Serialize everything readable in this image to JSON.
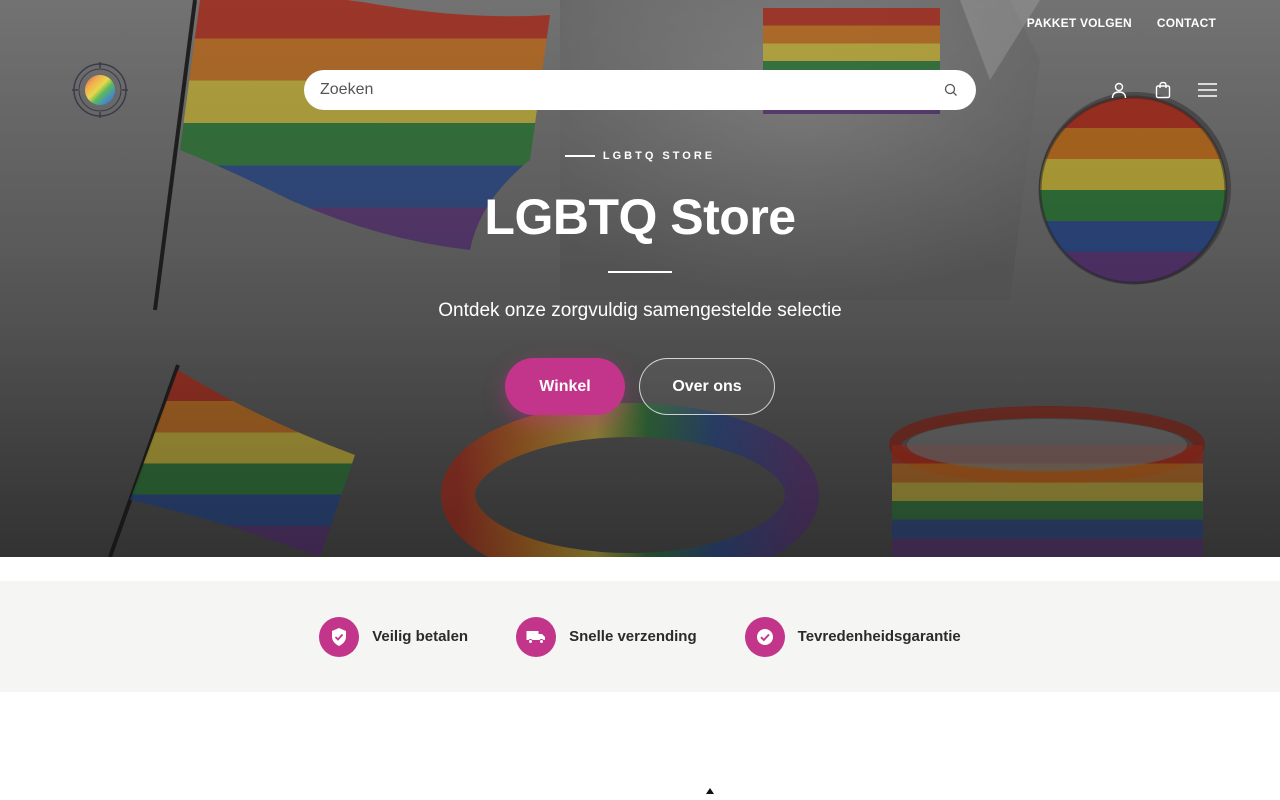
{
  "top_nav": {
    "track_label": "PAKKET VOLGEN",
    "contact_label": "CONTACT"
  },
  "search": {
    "placeholder": "Zoeken",
    "icon": "search-icon"
  },
  "header_icons": [
    "account-icon",
    "bag-icon",
    "menu-icon"
  ],
  "hero": {
    "eyebrow": "LGBTQ STORE",
    "title": "LGBTQ Store",
    "subtitle": "Ontdek onze zorgvuldig samengestelde selectie",
    "primary_button": "Winkel",
    "secondary_button": "Over ons"
  },
  "features": [
    {
      "label": "Veilig betalen",
      "icon": "shield-check-icon"
    },
    {
      "label": "Snelle verzending",
      "icon": "truck-icon"
    },
    {
      "label": "Tevredenheidsgarantie",
      "icon": "check-circle-icon"
    }
  ],
  "colors": {
    "accent": "#c2358b",
    "feature_bg": "#f5f5f3",
    "text_dark": "#2b2b2b"
  }
}
